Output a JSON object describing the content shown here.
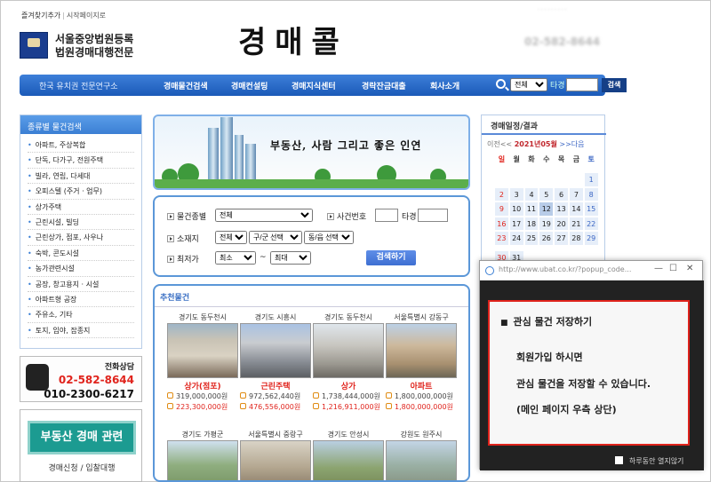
{
  "top_links": {
    "bookmark": "즐겨찾기추가",
    "homepage": "시작페이지로"
  },
  "tiny_right": "· · · · · · · · ·",
  "corp": {
    "line1": "서울중앙법원등록",
    "line2": "법원경매대행전문"
  },
  "brand": "경매콜",
  "header_phone": "02-582-8644",
  "nav": {
    "lead": "한국 유치권 전문연구소",
    "items": [
      "경매물건검색",
      "경매컨설팅",
      "경매지식센터",
      "경락잔금대출",
      "회사소개"
    ],
    "select_value": "전체",
    "type_label": "타경",
    "search_button": "검색"
  },
  "left_menu": {
    "title": "종류별 물건검색",
    "items": [
      "아파트, 주상복합",
      "단독, 다가구, 전원주택",
      "빌라, 연립, 다세대",
      "오피스텔 (주거 · 업무)",
      "상가주택",
      "근린시설, 빌딩",
      "근린상가, 점포, 사우나",
      "숙박, 콘도시설",
      "농가관련시설",
      "공장, 창고용지 · 시설",
      "아파트형 공장",
      "주유소, 기타",
      "토지, 임야, 잡종지"
    ]
  },
  "tel": {
    "label": "전화상담",
    "num1": "02-582-8644",
    "num2": "010-2300-6217"
  },
  "lowerbox": {
    "button": "부동산 경매 관련",
    "text": "경매신청 / 입찰대행"
  },
  "banner": {
    "slogan": "부동산, 사람 그리고 좋은 인연"
  },
  "search": {
    "type_label": "물건종별",
    "type_value": "전체",
    "case_label": "사건번호",
    "case_mid": "타경",
    "region_label": "소재지",
    "region_values": [
      "전체",
      "구/군 선택",
      "동/읍 선택"
    ],
    "price_label": "최저가",
    "price_min": "최소",
    "price_tilde": "~",
    "price_max": "최대",
    "button": "검색하기"
  },
  "recommend": {
    "title": "추천물건",
    "cards": [
      {
        "loc": "경기도 동두천시",
        "type": "상가(점포)",
        "p1": "319,000,000원",
        "p2": "223,300,000원"
      },
      {
        "loc": "경기도 시흥시",
        "type": "근린주택",
        "p1": "972,562,440원",
        "p2": "476,556,000원"
      },
      {
        "loc": "경기도 동두천시",
        "type": "상가",
        "p1": "1,738,444,000원",
        "p2": "1,216,911,000원"
      },
      {
        "loc": "서울특별시 강동구",
        "type": "아파트",
        "p1": "1,800,000,000원",
        "p2": "1,800,000,000원"
      },
      {
        "loc": "경기도 가평군",
        "type": "",
        "p1": "",
        "p2": ""
      },
      {
        "loc": "서울특별시 중랑구",
        "type": "",
        "p1": "",
        "p2": ""
      },
      {
        "loc": "경기도 안성시",
        "type": "",
        "p1": "",
        "p2": ""
      },
      {
        "loc": "강원도 원주시",
        "type": "",
        "p1": "",
        "p2": ""
      }
    ]
  },
  "calendar": {
    "title": "경매일정/결과",
    "prev": "이전<<",
    "month": "2021년05월",
    "next": ">>다음",
    "dows": [
      "일",
      "월",
      "화",
      "수",
      "목",
      "금",
      "토"
    ],
    "weeks": [
      [
        "",
        "",
        "",
        "",
        "",
        "",
        "1"
      ],
      [
        "2",
        "3",
        "4",
        "5",
        "6",
        "7",
        "8"
      ],
      [
        "9",
        "10",
        "11",
        "12",
        "13",
        "14",
        "15"
      ],
      [
        "16",
        "17",
        "18",
        "19",
        "20",
        "21",
        "22"
      ],
      [
        "23",
        "24",
        "25",
        "26",
        "27",
        "28",
        "29"
      ],
      [
        "30",
        "31",
        "",
        "",
        "",
        "",
        ""
      ]
    ],
    "today": "12"
  },
  "popup": {
    "url": "http://www.ubat.co.kr/?popup_code...",
    "min": "—",
    "max": "☐",
    "close": "✕",
    "title": "관심 물건 저장하기",
    "msg1": "회원가입 하시면",
    "msg2": "관심 물건을 저장할 수 있습니다.",
    "msg3": "(메인 페이지 우측 상단)",
    "footer": "하루동안 열지않기"
  }
}
